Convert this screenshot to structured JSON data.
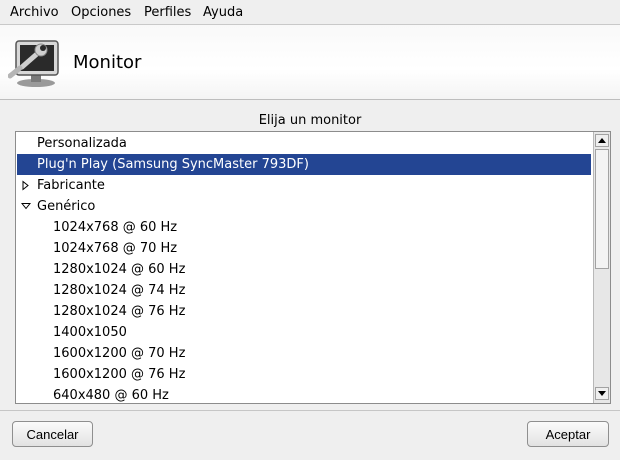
{
  "menubar": {
    "items": [
      {
        "label": "Archivo"
      },
      {
        "label": "Opciones"
      },
      {
        "label": "Perfiles"
      },
      {
        "label": "Ayuda"
      }
    ]
  },
  "header": {
    "title": "Monitor",
    "icon": "monitor-wrench-icon"
  },
  "monitor_list": {
    "heading": "Elija un monitor",
    "rows": [
      {
        "label": "Personalizada",
        "selected": false
      },
      {
        "label": "Plug'n Play (Samsung SyncMaster 793DF)",
        "selected": true
      },
      {
        "label": "Fabricante",
        "expander": "collapsed"
      },
      {
        "label": "Genérico",
        "expander": "expanded"
      },
      {
        "label": "1024x768 @ 60 Hz"
      },
      {
        "label": "1024x768 @ 70 Hz"
      },
      {
        "label": "1280x1024 @ 60 Hz"
      },
      {
        "label": "1280x1024 @ 74 Hz"
      },
      {
        "label": "1280x1024 @ 76 Hz"
      },
      {
        "label": "1400x1050"
      },
      {
        "label": "1600x1200 @ 70 Hz"
      },
      {
        "label": "1600x1200 @ 76 Hz"
      },
      {
        "label": "640x480 @ 60 Hz"
      }
    ]
  },
  "buttons": {
    "cancel": "Cancelar",
    "accept": "Aceptar"
  },
  "colors": {
    "selection": "#234593",
    "selection_text": "#ffffff"
  }
}
